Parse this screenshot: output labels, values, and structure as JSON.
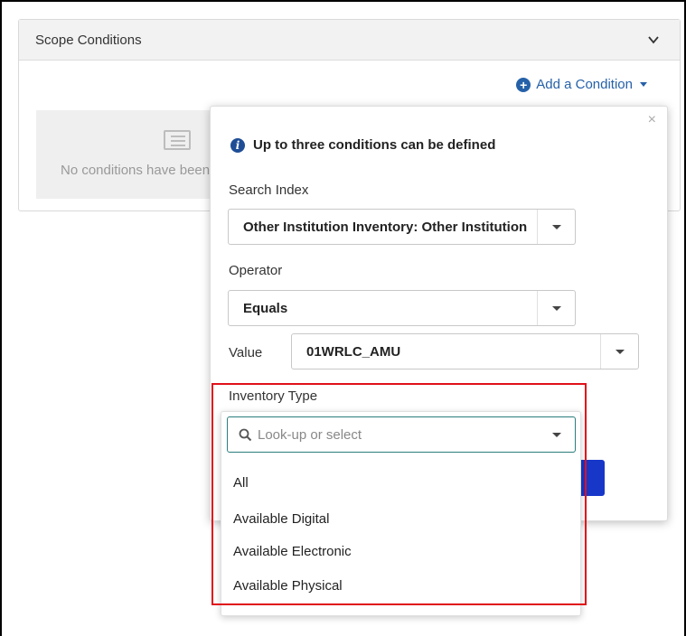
{
  "scope": {
    "title": "Scope Conditions",
    "add_condition": "Add a Condition",
    "empty_text": "No conditions have been defined"
  },
  "popover": {
    "info": "Up to three conditions can be defined",
    "close": "×",
    "search_index_label": "Search Index",
    "search_index_value": "Other Institution Inventory: Other Institution",
    "operator_label": "Operator",
    "operator_value": "Equals",
    "value_label": "Value",
    "value_value": "01WRLC_AMU",
    "inventory_type_label": "Inventory Type",
    "inventory_type_placeholder": "Look-up or select",
    "inventory_type_options": [
      "All",
      "Available Digital",
      "Available Electronic",
      "Available Physical"
    ]
  },
  "colors": {
    "accent": "#2561a8",
    "highlight": "#e0101a",
    "primary_button": "#1737c9"
  },
  "icons": {
    "header": "chevron-down-icon",
    "add": "plus-circle-icon",
    "empty": "list-icon",
    "info": "info-circle-icon",
    "search": "search-icon"
  }
}
